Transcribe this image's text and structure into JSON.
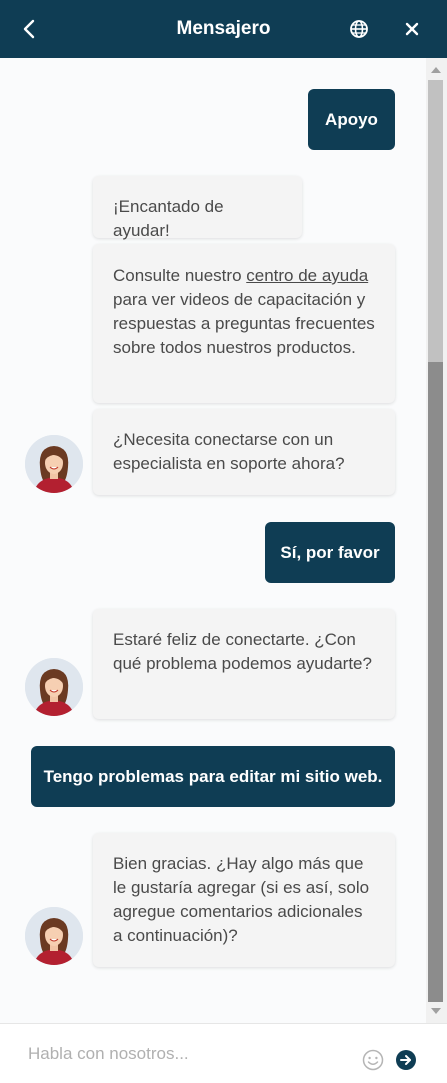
{
  "header": {
    "title": "Mensajero",
    "back_icon": "chevron-left-icon",
    "language_icon": "globe-icon",
    "close_icon": "close-icon"
  },
  "messages": [
    {
      "from": "user",
      "text": "Apoyo"
    },
    {
      "from": "bot",
      "text": "¡Encantado de ayudar!"
    },
    {
      "from": "bot",
      "text_before": "Consulte nuestro ",
      "link_text": "centro de ayuda",
      "text_after": " para ver videos de capacitación y respuestas a preguntas frecuentes sobre todos nuestros productos."
    },
    {
      "from": "bot",
      "text": "¿Necesita conectarse con un especialista en soporte ahora?"
    },
    {
      "from": "user",
      "text": "Sí, por favor"
    },
    {
      "from": "bot",
      "text": "Estaré feliz de conectarte. ¿Con qué problema podemos ayudarte?"
    },
    {
      "from": "user",
      "text": "Tengo problemas para editar mi sitio web."
    },
    {
      "from": "bot",
      "text": "Bien gracias. ¿Hay algo más que le gustaría agregar (si es así, solo agregue comentarios adicionales a continuación)?"
    }
  ],
  "composer": {
    "placeholder": "Habla con nosotros...",
    "emoji_icon": "smiley-icon",
    "send_icon": "send-arrow-icon"
  },
  "colors": {
    "brand": "#0f3d54",
    "bot_bubble": "#f4f4f4",
    "background": "#fafbfc"
  }
}
